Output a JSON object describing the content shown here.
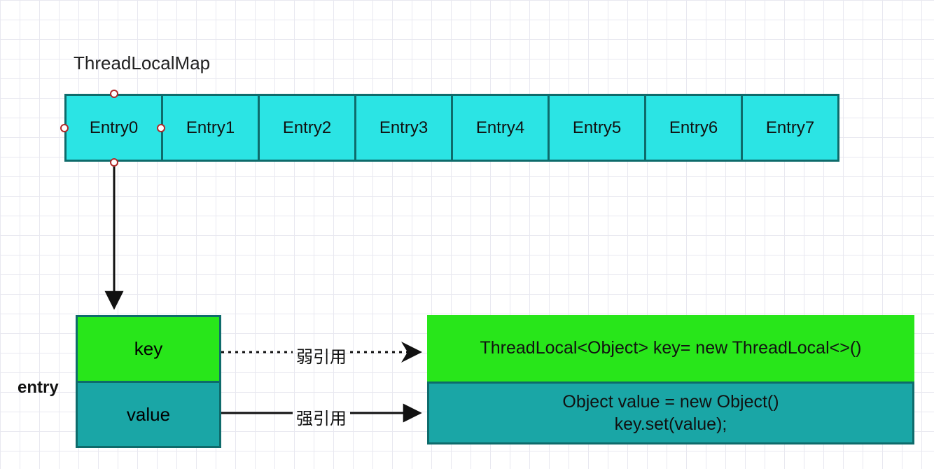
{
  "title": "ThreadLocalMap",
  "entries": [
    "Entry0",
    "Entry1",
    "Entry2",
    "Entry3",
    "Entry4",
    "Entry5",
    "Entry6",
    "Entry7"
  ],
  "entry_label": "entry",
  "kv": {
    "key": "key",
    "value": "value"
  },
  "refs": {
    "weak": "弱引用",
    "strong": "强引用"
  },
  "code": {
    "key_line": "ThreadLocal<Object> key= new ThreadLocal<>()",
    "value_line1": "Object value = new Object()",
    "value_line2": "key.set(value);"
  },
  "colors": {
    "cyan": "#2be4e4",
    "green": "#28e61a",
    "teal": "#1aa6a6",
    "border": "#0e6b6b"
  }
}
